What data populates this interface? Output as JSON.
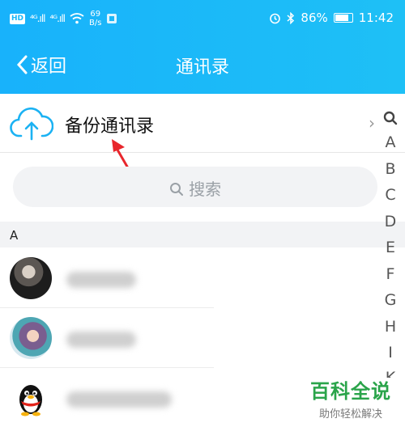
{
  "status_bar": {
    "hd": "HD",
    "sig1": "⁴ᴳ.ıll",
    "sig2": "⁴ᴳ.ıll",
    "speed_value": "69",
    "speed_unit": "B/s",
    "battery": "86%",
    "time": "11:42"
  },
  "nav": {
    "back_label": "返回",
    "title": "通讯录"
  },
  "backup": {
    "label": "备份通讯录"
  },
  "search": {
    "placeholder": "搜索"
  },
  "section_header": "A",
  "index_letters": [
    "A",
    "B",
    "C",
    "D",
    "E",
    "F",
    "G",
    "H",
    "I",
    "K"
  ],
  "watermark": {
    "line1": "百科全说",
    "line2": "助你轻松解决"
  },
  "colors": {
    "header": "#18b2fb",
    "arrow": "#e8262c",
    "watermark": "#2aa44a"
  }
}
